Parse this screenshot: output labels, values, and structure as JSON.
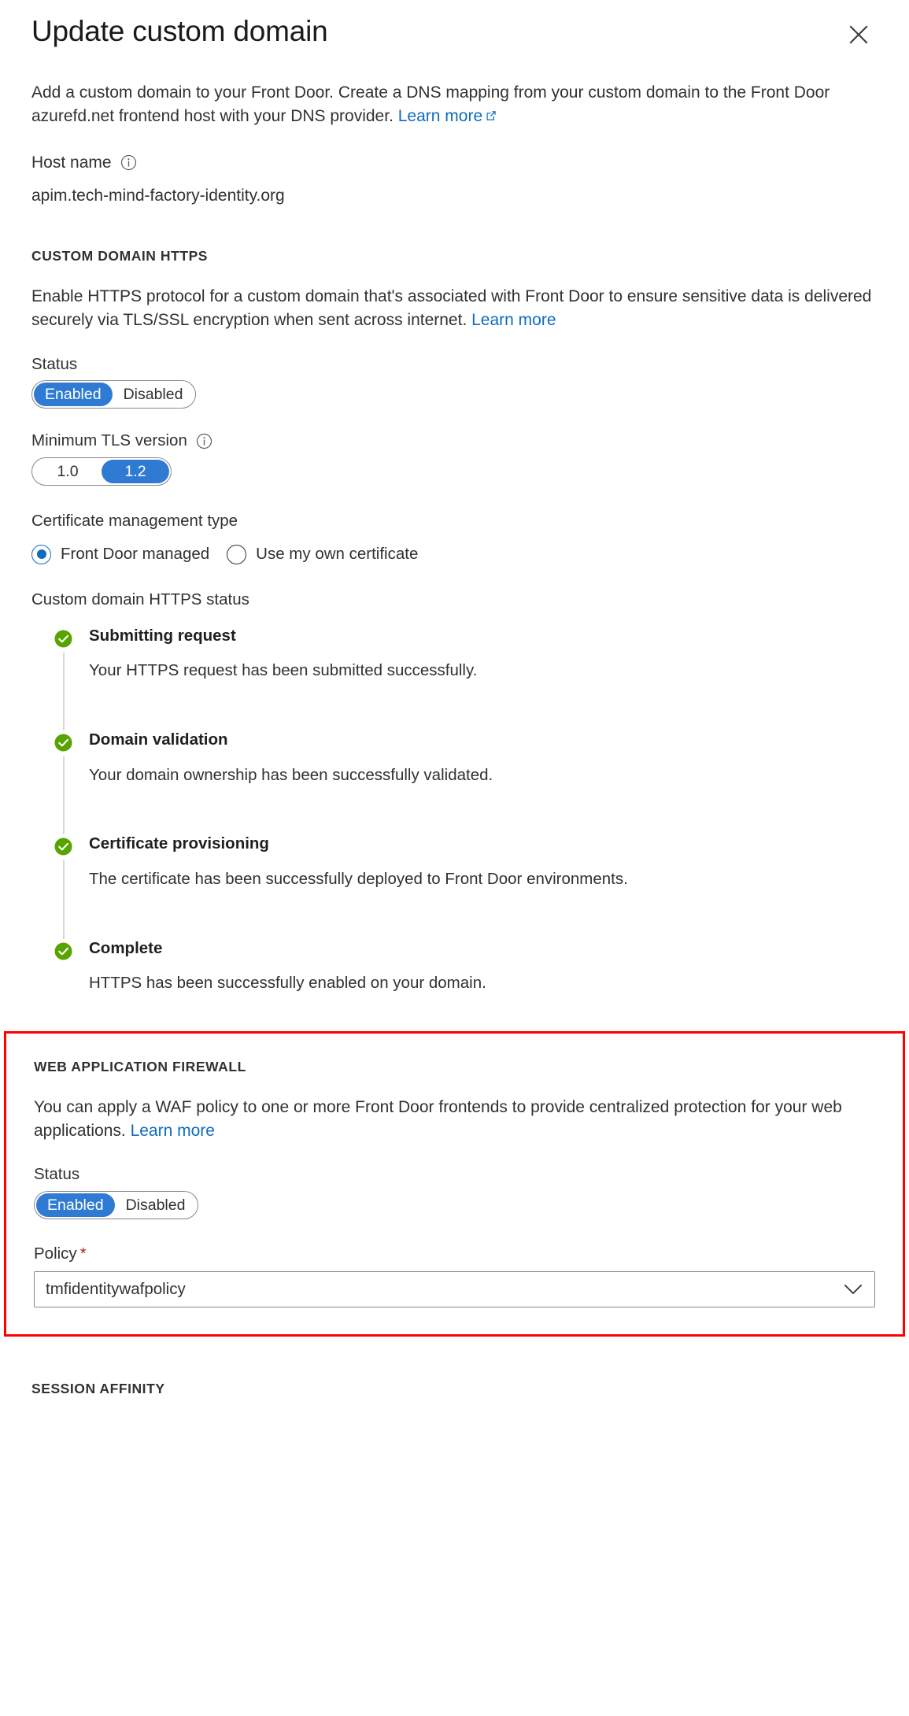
{
  "header": {
    "title": "Update custom domain",
    "close_label": "Close"
  },
  "intro": {
    "text": "Add a custom domain to your Front Door. Create a DNS mapping from your custom domain to the Front Door azurefd.net frontend host with your DNS provider. ",
    "link_label": "Learn more"
  },
  "host_name": {
    "label": "Host name",
    "value": "apim.tech-mind-factory-identity.org"
  },
  "https_section": {
    "title": "CUSTOM DOMAIN HTTPS",
    "description": "Enable HTTPS protocol for a custom domain that's associated with Front Door to ensure sensitive data is delivered securely via TLS/SSL encryption when sent across internet. ",
    "link_label": "Learn more",
    "status": {
      "label": "Status",
      "options": [
        "Enabled",
        "Disabled"
      ],
      "selected": "Enabled"
    },
    "tls": {
      "label": "Minimum TLS version",
      "options": [
        "1.0",
        "1.2"
      ],
      "selected": "1.2"
    },
    "cert_mgmt": {
      "label": "Certificate management type",
      "options": [
        "Front Door managed",
        "Use my own certificate"
      ],
      "selected": "Front Door managed"
    },
    "status_list_label": "Custom domain HTTPS status",
    "steps": [
      {
        "title": "Submitting request",
        "description": "Your HTTPS request has been submitted successfully.",
        "state": "complete"
      },
      {
        "title": "Domain validation",
        "description": "Your domain ownership has been successfully validated.",
        "state": "complete"
      },
      {
        "title": "Certificate provisioning",
        "description": "The certificate has been successfully deployed to Front Door environments.",
        "state": "complete"
      },
      {
        "title": "Complete",
        "description": "HTTPS has been successfully enabled on your domain.",
        "state": "complete"
      }
    ]
  },
  "waf_section": {
    "title": "WEB APPLICATION FIREWALL",
    "description": "You can apply a WAF policy to one or more Front Door frontends to provide centralized protection for your web applications. ",
    "link_label": "Learn more",
    "status": {
      "label": "Status",
      "options": [
        "Enabled",
        "Disabled"
      ],
      "selected": "Enabled"
    },
    "policy": {
      "label": "Policy",
      "required_marker": "*",
      "value": "tmfidentitywafpolicy"
    },
    "highlight_color": "#fe0000"
  },
  "session_affinity": {
    "title": "SESSION AFFINITY"
  },
  "colors": {
    "accent_blue": "#2f7bd4",
    "link_blue": "#0f6cbd",
    "success_green": "#57a300",
    "required_red": "#a4262c",
    "highlight_red": "#fe0000"
  }
}
